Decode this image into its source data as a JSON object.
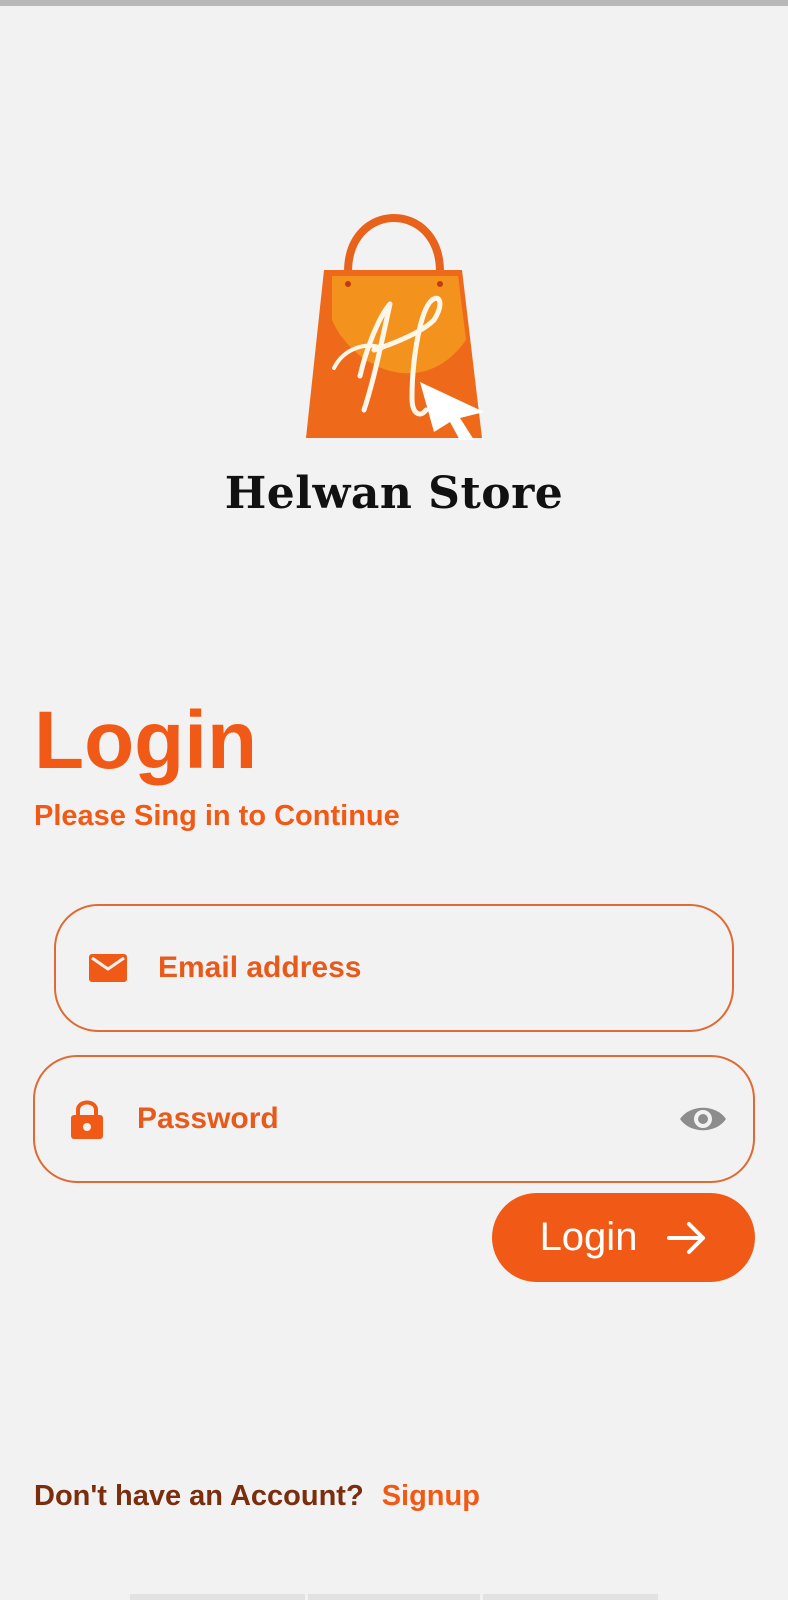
{
  "brand": {
    "name": "Helwan Store",
    "accent_color": "#f15a16"
  },
  "login": {
    "title": "Login",
    "subtitle": "Please Sing in to Continue",
    "email_placeholder": "Email address",
    "password_placeholder": "Password",
    "button_label": "Login"
  },
  "signup": {
    "question": "Don't have an Account?",
    "link_label": "Signup"
  },
  "icons": {
    "email": "mail-icon",
    "password": "lock-icon",
    "toggle": "eye-icon",
    "submit": "arrow-right-icon"
  }
}
